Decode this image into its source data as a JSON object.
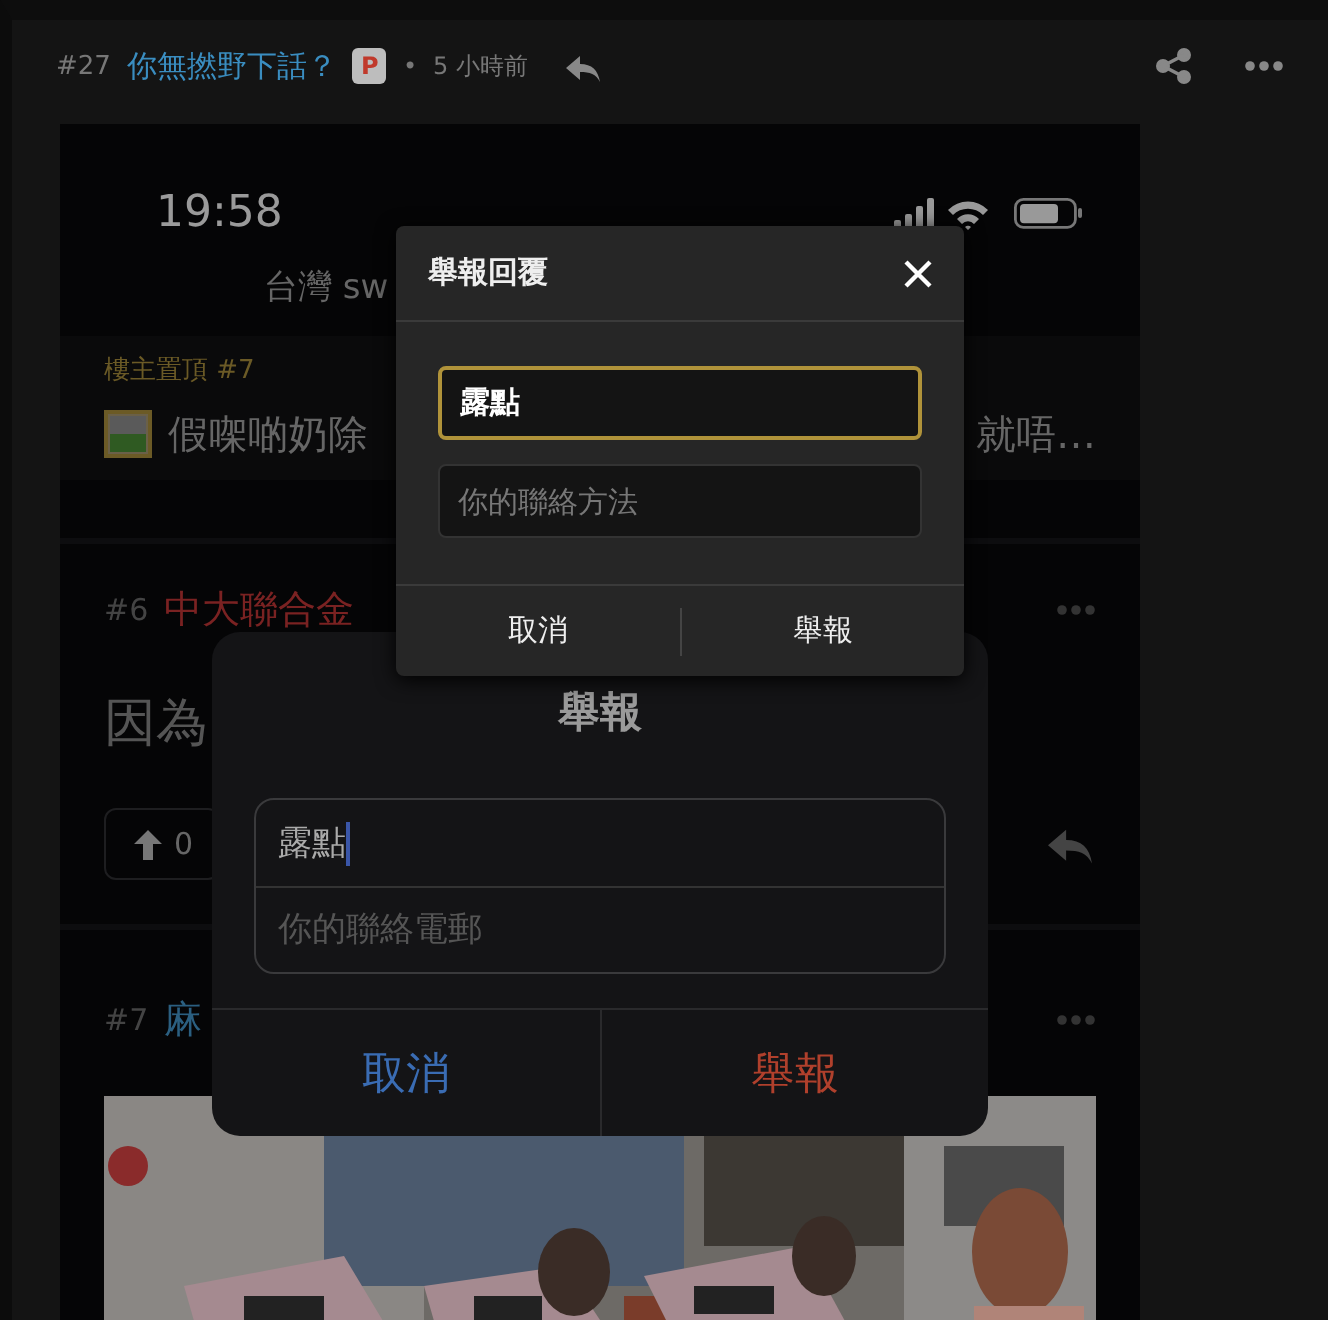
{
  "post": {
    "number": "#27",
    "title": "你無撚野下話？",
    "badge": "P",
    "separator": "•",
    "time": "5 小時前"
  },
  "screenshot": {
    "time": "19:58",
    "header_text": "台灣 sw",
    "pinned": {
      "label": "樓主置頂 #7",
      "text_start": "假㗎啲奶除",
      "text_end": "就唔…"
    },
    "replies": [
      {
        "number": "#6",
        "title": "中大聯合金",
        "color": "#7a2222",
        "body": "因為",
        "votes": "0"
      },
      {
        "number": "#7",
        "title": "麻",
        "color": "#2b5f80"
      }
    ],
    "alert": {
      "title": "舉報",
      "value": "露點",
      "placeholder": "你的聯絡電郵",
      "buttons": [
        {
          "label": "取消",
          "kind": "cancel"
        },
        {
          "label": "舉報",
          "kind": "destructive"
        }
      ]
    }
  },
  "dialog": {
    "title": "舉報回覆",
    "fields": [
      {
        "value": "露點",
        "focused": true
      },
      {
        "placeholder": "你的聯絡方法",
        "focused": false
      }
    ],
    "buttons": [
      "取消",
      "舉報"
    ]
  }
}
